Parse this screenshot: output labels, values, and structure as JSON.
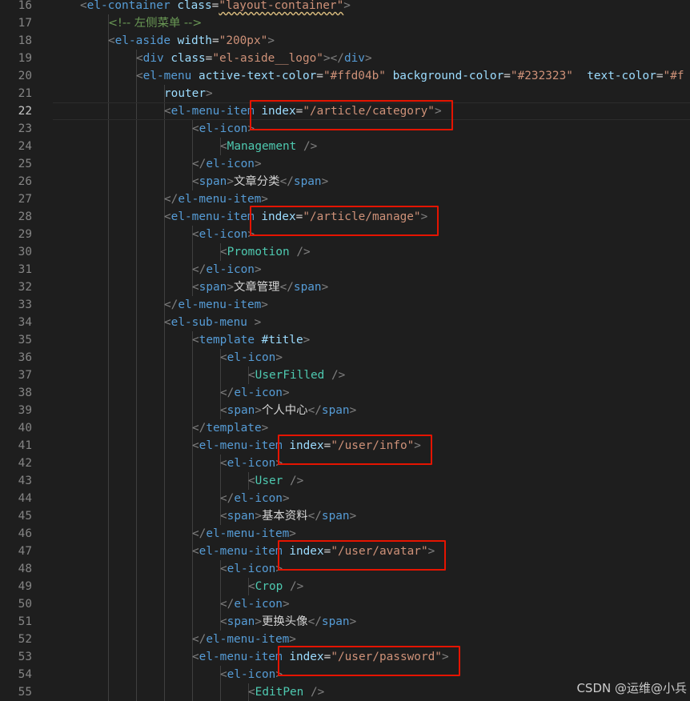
{
  "editor": {
    "active_line": 22,
    "lines": [
      {
        "n": 16,
        "indent": 1,
        "tokens": [
          [
            "punc",
            "<"
          ],
          [
            "tag",
            "el-container"
          ],
          [
            "text",
            " "
          ],
          [
            "attr",
            "class"
          ],
          [
            "text",
            "="
          ],
          [
            "str",
            "\"layout-container\"",
            true
          ],
          [
            "punc",
            ">"
          ]
        ]
      },
      {
        "n": 17,
        "indent": 2,
        "tokens": [
          [
            "cmt",
            "<!-- 左侧菜单 -->"
          ]
        ]
      },
      {
        "n": 18,
        "indent": 2,
        "tokens": [
          [
            "punc",
            "<"
          ],
          [
            "tag",
            "el-aside"
          ],
          [
            "text",
            " "
          ],
          [
            "attr",
            "width"
          ],
          [
            "text",
            "="
          ],
          [
            "str",
            "\"200px\""
          ],
          [
            "punc",
            ">"
          ]
        ]
      },
      {
        "n": 19,
        "indent": 3,
        "tokens": [
          [
            "punc",
            "<"
          ],
          [
            "tag",
            "div"
          ],
          [
            "text",
            " "
          ],
          [
            "attr",
            "class"
          ],
          [
            "text",
            "="
          ],
          [
            "str",
            "\"el-aside__logo\""
          ],
          [
            "punc",
            "></"
          ],
          [
            "tag",
            "div"
          ],
          [
            "punc",
            ">"
          ]
        ]
      },
      {
        "n": 20,
        "indent": 3,
        "tokens": [
          [
            "punc",
            "<"
          ],
          [
            "tag",
            "el-menu"
          ],
          [
            "text",
            " "
          ],
          [
            "attr",
            "active-text-color"
          ],
          [
            "text",
            "="
          ],
          [
            "str",
            "\"#ffd04b\""
          ],
          [
            "text",
            " "
          ],
          [
            "attr",
            "background-color"
          ],
          [
            "text",
            "="
          ],
          [
            "str",
            "\"#232323\""
          ],
          [
            "text",
            "  "
          ],
          [
            "attr",
            "text-color"
          ],
          [
            "text",
            "="
          ],
          [
            "str",
            "\"#f"
          ]
        ]
      },
      {
        "n": 21,
        "indent": 4,
        "tokens": [
          [
            "attr",
            "router"
          ],
          [
            "punc",
            ">"
          ]
        ]
      },
      {
        "n": 22,
        "indent": 4,
        "tokens": [
          [
            "punc",
            "<"
          ],
          [
            "tag",
            "el-menu-item"
          ],
          [
            "text",
            " "
          ],
          [
            "attr",
            "index"
          ],
          [
            "text",
            "="
          ],
          [
            "str",
            "\"/article/category\""
          ],
          [
            "punc",
            ">"
          ]
        ]
      },
      {
        "n": 23,
        "indent": 5,
        "tokens": [
          [
            "punc",
            "<"
          ],
          [
            "tag",
            "el-icon"
          ],
          [
            "punc",
            ">"
          ]
        ]
      },
      {
        "n": 24,
        "indent": 6,
        "tokens": [
          [
            "punc",
            "<"
          ],
          [
            "comp",
            "Management"
          ],
          [
            "text",
            " "
          ],
          [
            "punc",
            "/>"
          ]
        ]
      },
      {
        "n": 25,
        "indent": 5,
        "tokens": [
          [
            "punc",
            "</"
          ],
          [
            "tag",
            "el-icon"
          ],
          [
            "punc",
            ">"
          ]
        ]
      },
      {
        "n": 26,
        "indent": 5,
        "tokens": [
          [
            "punc",
            "<"
          ],
          [
            "tag",
            "span"
          ],
          [
            "punc",
            ">"
          ],
          [
            "text",
            "文章分类"
          ],
          [
            "punc",
            "</"
          ],
          [
            "tag",
            "span"
          ],
          [
            "punc",
            ">"
          ]
        ]
      },
      {
        "n": 27,
        "indent": 4,
        "tokens": [
          [
            "punc",
            "</"
          ],
          [
            "tag",
            "el-menu-item"
          ],
          [
            "punc",
            ">"
          ]
        ]
      },
      {
        "n": 28,
        "indent": 4,
        "tokens": [
          [
            "punc",
            "<"
          ],
          [
            "tag",
            "el-menu-item"
          ],
          [
            "text",
            " "
          ],
          [
            "attr",
            "index"
          ],
          [
            "text",
            "="
          ],
          [
            "str",
            "\"/article/manage\""
          ],
          [
            "punc",
            ">"
          ]
        ]
      },
      {
        "n": 29,
        "indent": 5,
        "tokens": [
          [
            "punc",
            "<"
          ],
          [
            "tag",
            "el-icon"
          ],
          [
            "punc",
            ">"
          ]
        ]
      },
      {
        "n": 30,
        "indent": 6,
        "tokens": [
          [
            "punc",
            "<"
          ],
          [
            "comp",
            "Promotion"
          ],
          [
            "text",
            " "
          ],
          [
            "punc",
            "/>"
          ]
        ]
      },
      {
        "n": 31,
        "indent": 5,
        "tokens": [
          [
            "punc",
            "</"
          ],
          [
            "tag",
            "el-icon"
          ],
          [
            "punc",
            ">"
          ]
        ]
      },
      {
        "n": 32,
        "indent": 5,
        "tokens": [
          [
            "punc",
            "<"
          ],
          [
            "tag",
            "span"
          ],
          [
            "punc",
            ">"
          ],
          [
            "text",
            "文章管理"
          ],
          [
            "punc",
            "</"
          ],
          [
            "tag",
            "span"
          ],
          [
            "punc",
            ">"
          ]
        ]
      },
      {
        "n": 33,
        "indent": 4,
        "tokens": [
          [
            "punc",
            "</"
          ],
          [
            "tag",
            "el-menu-item"
          ],
          [
            "punc",
            ">"
          ]
        ]
      },
      {
        "n": 34,
        "indent": 4,
        "tokens": [
          [
            "punc",
            "<"
          ],
          [
            "tag",
            "el-sub-menu"
          ],
          [
            "text",
            " "
          ],
          [
            "punc",
            ">"
          ]
        ]
      },
      {
        "n": 35,
        "indent": 5,
        "tokens": [
          [
            "punc",
            "<"
          ],
          [
            "tag",
            "template"
          ],
          [
            "text",
            " "
          ],
          [
            "attr",
            "#title"
          ],
          [
            "punc",
            ">"
          ]
        ]
      },
      {
        "n": 36,
        "indent": 6,
        "tokens": [
          [
            "punc",
            "<"
          ],
          [
            "tag",
            "el-icon"
          ],
          [
            "punc",
            ">"
          ]
        ]
      },
      {
        "n": 37,
        "indent": 7,
        "tokens": [
          [
            "punc",
            "<"
          ],
          [
            "comp",
            "UserFilled"
          ],
          [
            "text",
            " "
          ],
          [
            "punc",
            "/>"
          ]
        ]
      },
      {
        "n": 38,
        "indent": 6,
        "tokens": [
          [
            "punc",
            "</"
          ],
          [
            "tag",
            "el-icon"
          ],
          [
            "punc",
            ">"
          ]
        ]
      },
      {
        "n": 39,
        "indent": 6,
        "tokens": [
          [
            "punc",
            "<"
          ],
          [
            "tag",
            "span"
          ],
          [
            "punc",
            ">"
          ],
          [
            "text",
            "个人中心"
          ],
          [
            "punc",
            "</"
          ],
          [
            "tag",
            "span"
          ],
          [
            "punc",
            ">"
          ]
        ]
      },
      {
        "n": 40,
        "indent": 5,
        "tokens": [
          [
            "punc",
            "</"
          ],
          [
            "tag",
            "template"
          ],
          [
            "punc",
            ">"
          ]
        ]
      },
      {
        "n": 41,
        "indent": 5,
        "tokens": [
          [
            "punc",
            "<"
          ],
          [
            "tag",
            "el-menu-item"
          ],
          [
            "text",
            " "
          ],
          [
            "attr",
            "index"
          ],
          [
            "text",
            "="
          ],
          [
            "str",
            "\"/user/info\""
          ],
          [
            "punc",
            ">"
          ]
        ]
      },
      {
        "n": 42,
        "indent": 6,
        "tokens": [
          [
            "punc",
            "<"
          ],
          [
            "tag",
            "el-icon"
          ],
          [
            "punc",
            ">"
          ]
        ]
      },
      {
        "n": 43,
        "indent": 7,
        "tokens": [
          [
            "punc",
            "<"
          ],
          [
            "comp",
            "User"
          ],
          [
            "text",
            " "
          ],
          [
            "punc",
            "/>"
          ]
        ]
      },
      {
        "n": 44,
        "indent": 6,
        "tokens": [
          [
            "punc",
            "</"
          ],
          [
            "tag",
            "el-icon"
          ],
          [
            "punc",
            ">"
          ]
        ]
      },
      {
        "n": 45,
        "indent": 6,
        "tokens": [
          [
            "punc",
            "<"
          ],
          [
            "tag",
            "span"
          ],
          [
            "punc",
            ">"
          ],
          [
            "text",
            "基本资料"
          ],
          [
            "punc",
            "</"
          ],
          [
            "tag",
            "span"
          ],
          [
            "punc",
            ">"
          ]
        ]
      },
      {
        "n": 46,
        "indent": 5,
        "tokens": [
          [
            "punc",
            "</"
          ],
          [
            "tag",
            "el-menu-item"
          ],
          [
            "punc",
            ">"
          ]
        ]
      },
      {
        "n": 47,
        "indent": 5,
        "tokens": [
          [
            "punc",
            "<"
          ],
          [
            "tag",
            "el-menu-item"
          ],
          [
            "text",
            " "
          ],
          [
            "attr",
            "index"
          ],
          [
            "text",
            "="
          ],
          [
            "str",
            "\"/user/avatar\""
          ],
          [
            "punc",
            ">"
          ]
        ]
      },
      {
        "n": 48,
        "indent": 6,
        "tokens": [
          [
            "punc",
            "<"
          ],
          [
            "tag",
            "el-icon"
          ],
          [
            "punc",
            ">"
          ]
        ]
      },
      {
        "n": 49,
        "indent": 7,
        "tokens": [
          [
            "punc",
            "<"
          ],
          [
            "comp",
            "Crop"
          ],
          [
            "text",
            " "
          ],
          [
            "punc",
            "/>"
          ]
        ]
      },
      {
        "n": 50,
        "indent": 6,
        "tokens": [
          [
            "punc",
            "</"
          ],
          [
            "tag",
            "el-icon"
          ],
          [
            "punc",
            ">"
          ]
        ]
      },
      {
        "n": 51,
        "indent": 6,
        "tokens": [
          [
            "punc",
            "<"
          ],
          [
            "tag",
            "span"
          ],
          [
            "punc",
            ">"
          ],
          [
            "text",
            "更换头像"
          ],
          [
            "punc",
            "</"
          ],
          [
            "tag",
            "span"
          ],
          [
            "punc",
            ">"
          ]
        ]
      },
      {
        "n": 52,
        "indent": 5,
        "tokens": [
          [
            "punc",
            "</"
          ],
          [
            "tag",
            "el-menu-item"
          ],
          [
            "punc",
            ">"
          ]
        ]
      },
      {
        "n": 53,
        "indent": 5,
        "tokens": [
          [
            "punc",
            "<"
          ],
          [
            "tag",
            "el-menu-item"
          ],
          [
            "text",
            " "
          ],
          [
            "attr",
            "index"
          ],
          [
            "text",
            "="
          ],
          [
            "str",
            "\"/user/password\""
          ],
          [
            "punc",
            ">"
          ]
        ]
      },
      {
        "n": 54,
        "indent": 6,
        "tokens": [
          [
            "punc",
            "<"
          ],
          [
            "tag",
            "el-icon"
          ],
          [
            "punc",
            ">"
          ]
        ]
      },
      {
        "n": 55,
        "indent": 7,
        "tokens": [
          [
            "punc",
            "<"
          ],
          [
            "comp",
            "EditPen"
          ],
          [
            "text",
            " "
          ],
          [
            "punc",
            "/>"
          ]
        ]
      }
    ],
    "highlighted_lines": [
      22,
      28,
      41,
      47,
      53
    ]
  },
  "colors": {
    "background": "#1e1e1e",
    "tag": "#569cd6",
    "attribute": "#9cdcfe",
    "string": "#ce9178",
    "comment": "#6a9955",
    "component": "#4ec9b0",
    "text": "#d4d4d4",
    "highlight_box": "#e51400"
  },
  "watermark": "CSDN @运维@小兵"
}
